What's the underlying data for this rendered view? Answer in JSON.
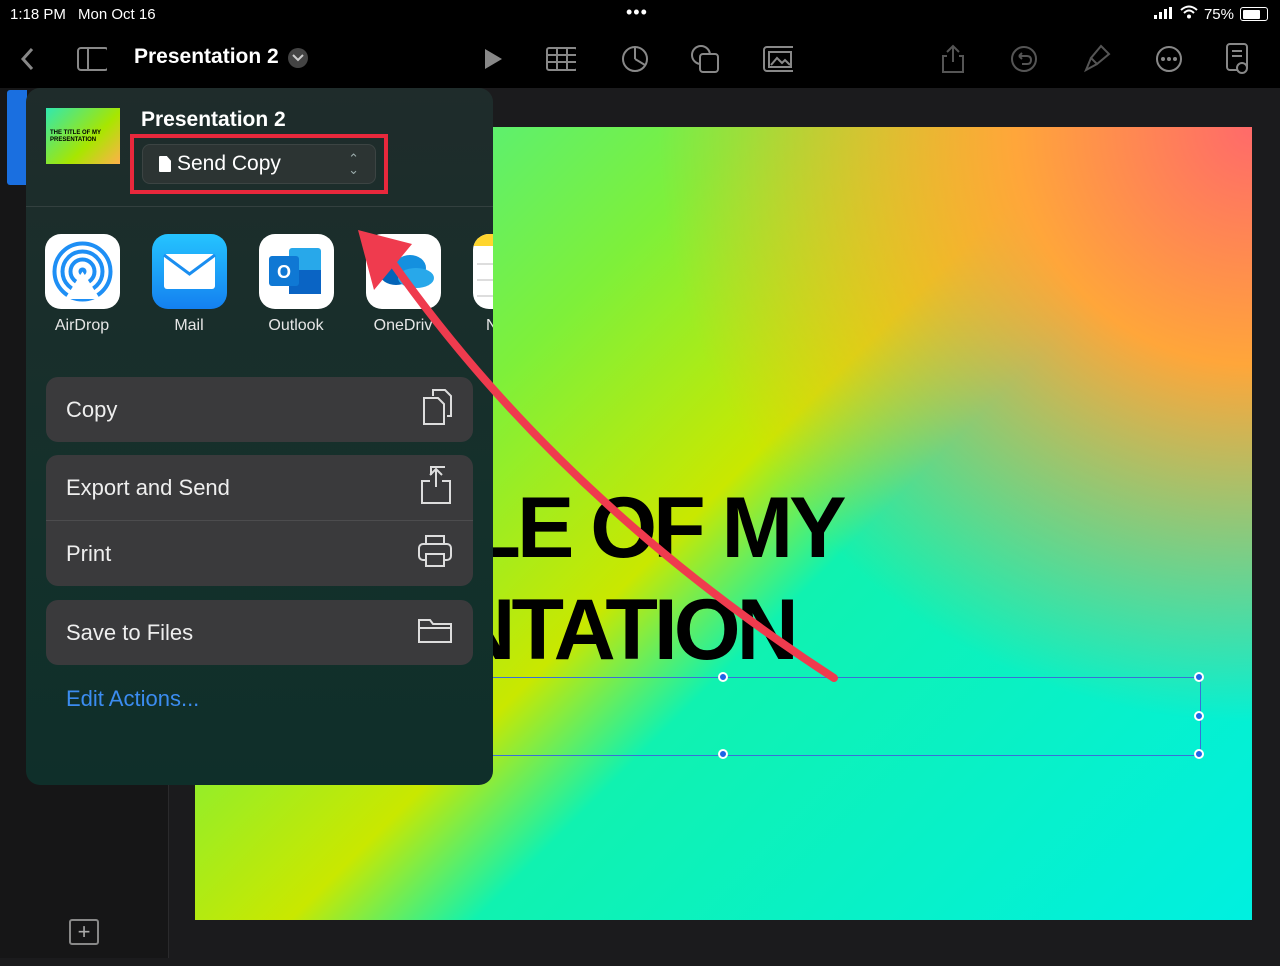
{
  "status_bar": {
    "time": "1:18 PM",
    "date": "Mon Oct 16",
    "dots": "•••",
    "battery": "75%"
  },
  "toolbar": {
    "title": "Presentation 2"
  },
  "slide": {
    "title_line1": "ITLE OF MY",
    "title_line2": "ENTATION"
  },
  "share_sheet": {
    "title": "Presentation 2",
    "thumbnail_text": "THE TITLE OF MY PRESENTATION",
    "send_mode": "Send Copy",
    "apps": [
      {
        "name": "AirDrop"
      },
      {
        "name": "Mail"
      },
      {
        "name": "Outlook"
      },
      {
        "name": "OneDriv"
      },
      {
        "name": "N"
      }
    ],
    "actions": {
      "copy": "Copy",
      "export_send": "Export and Send",
      "print": "Print",
      "save_files": "Save to Files"
    },
    "edit_actions": "Edit Actions..."
  },
  "colors": {
    "highlight": "#e8283c",
    "accent": "#3b8cf0",
    "selection": "#1f64e6"
  }
}
